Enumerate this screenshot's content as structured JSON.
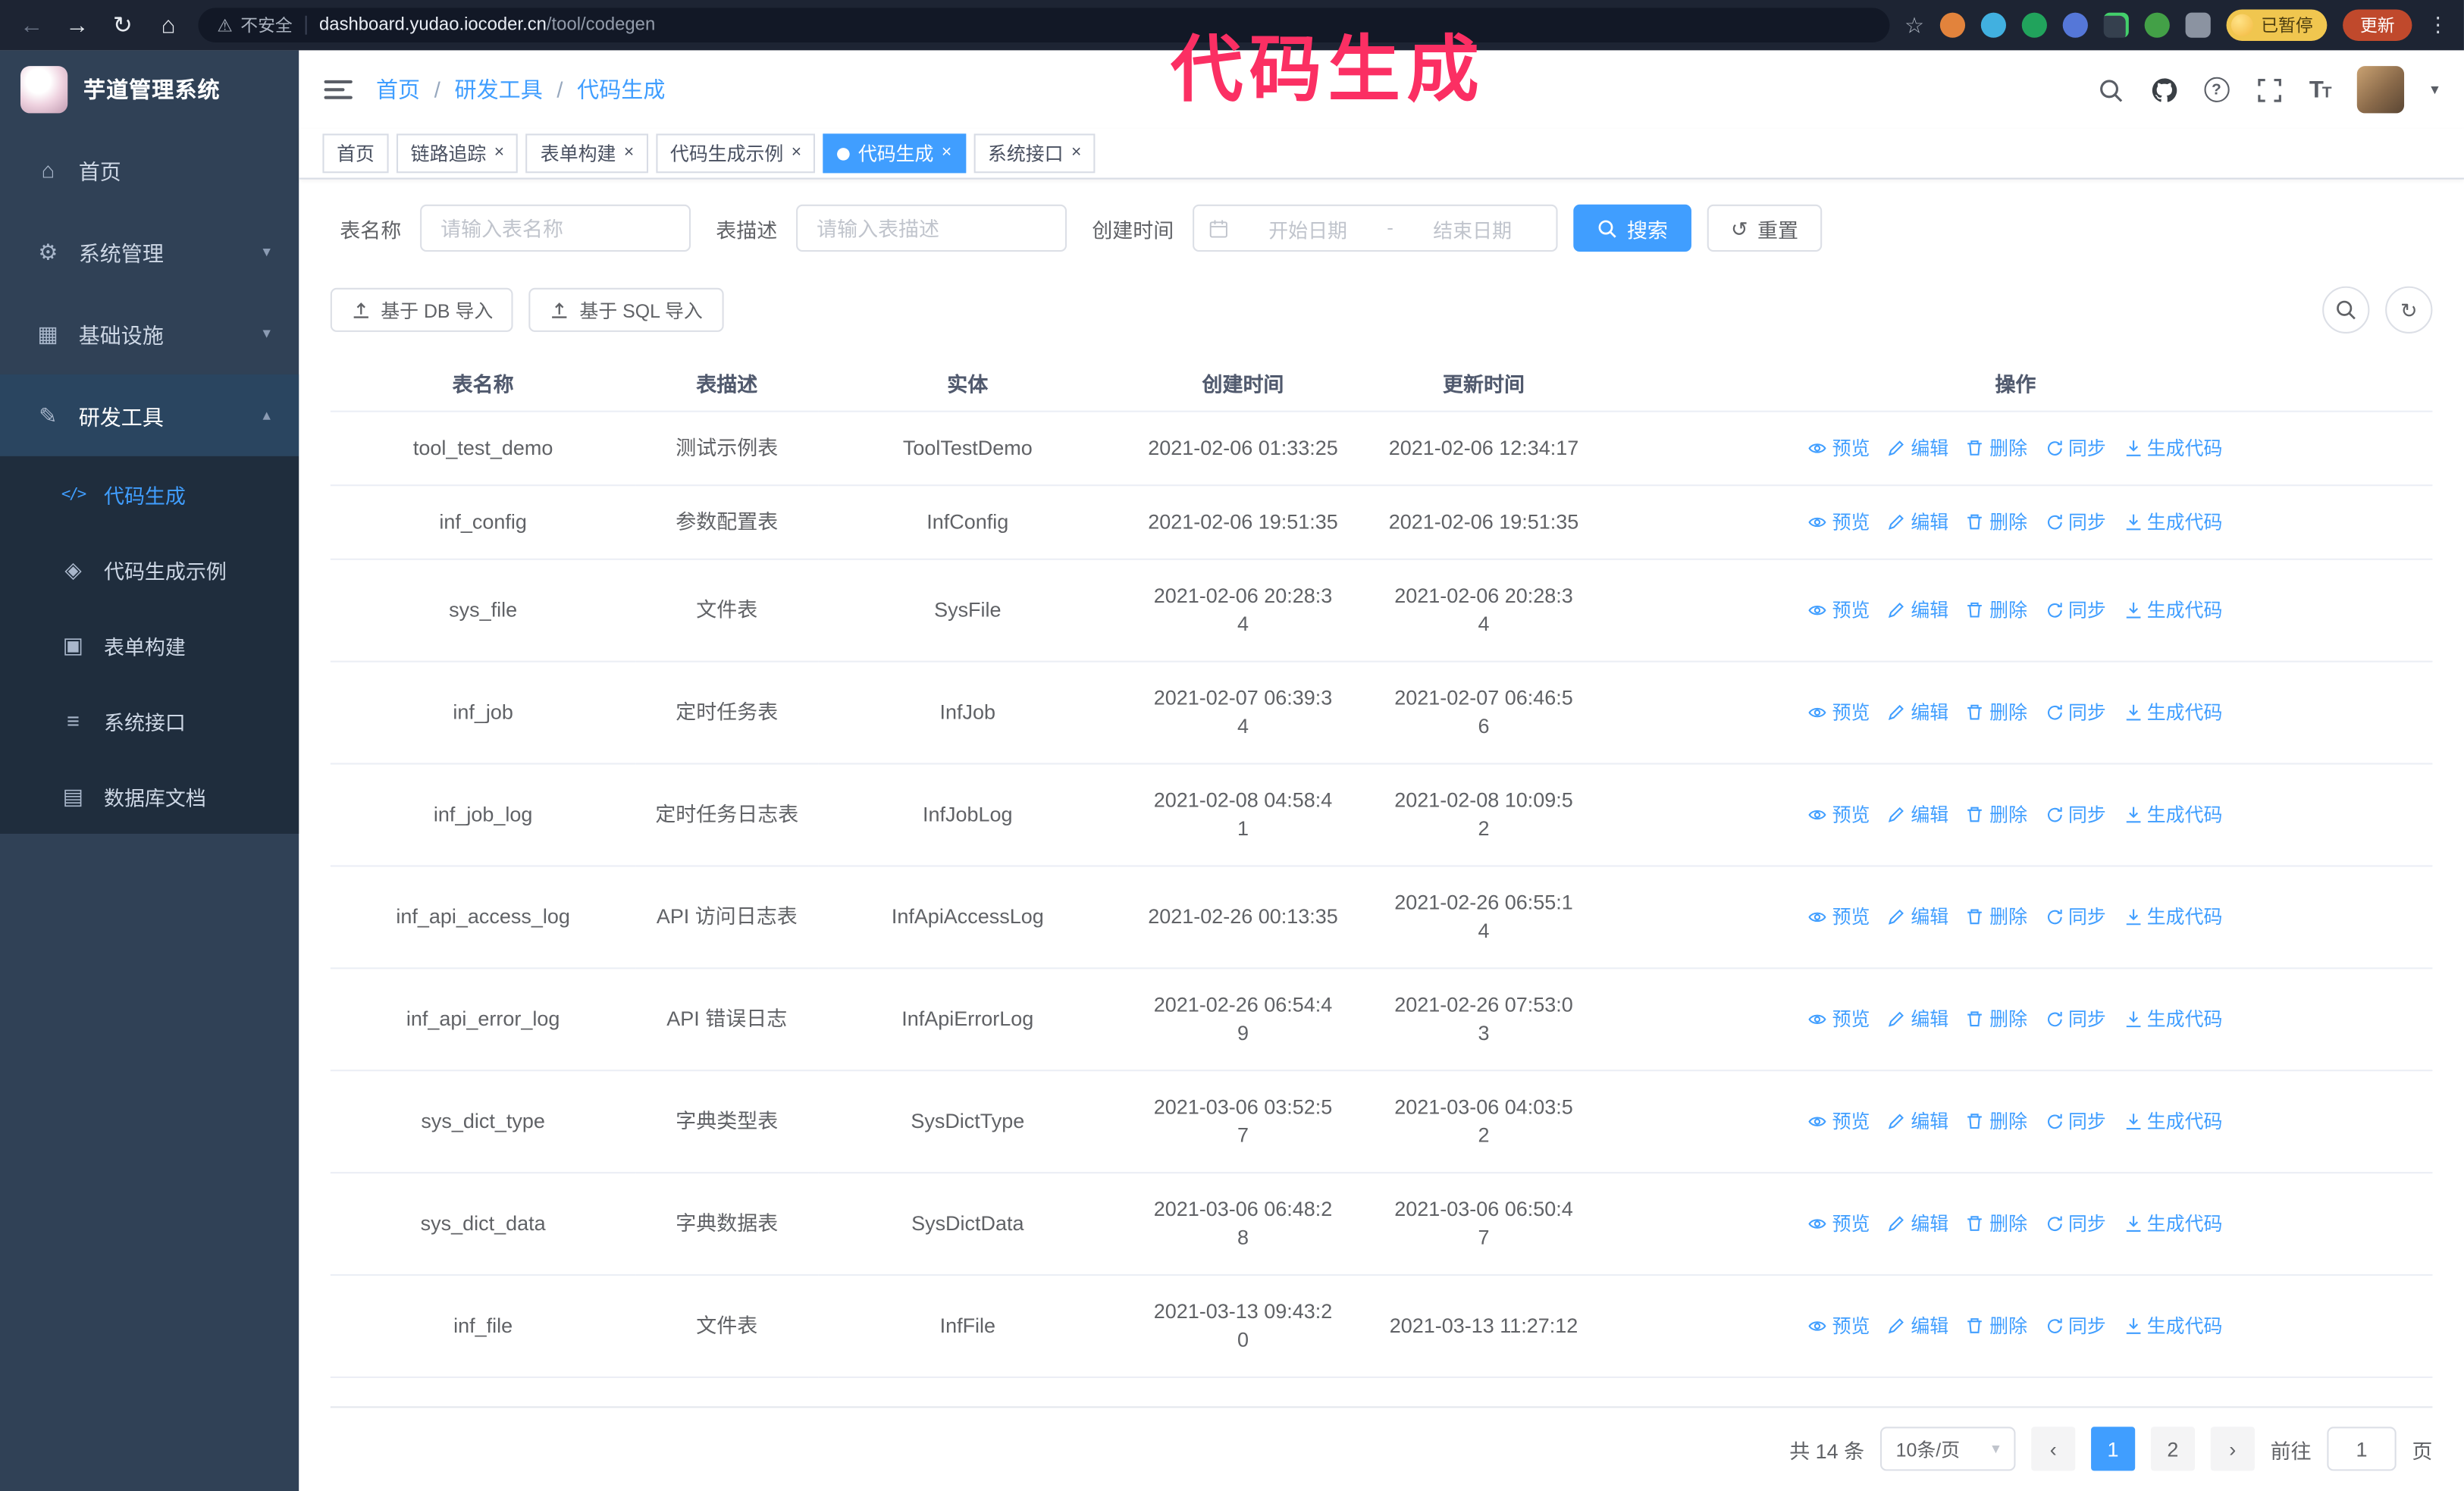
{
  "annotation": {
    "text": "代码生成",
    "color": "#fb2f63"
  },
  "colors": {
    "accent": "#409eff",
    "sidebar_bg": "#304156",
    "submenu_bg": "#1f2d3d",
    "chrome_bg": "#1d2433",
    "update_button_bg": "#c0492c",
    "profile_badge_bg": "#f0c64f"
  },
  "browser": {
    "security_label": "不安全",
    "url_host": "dashboard.yudao.iocoder.cn",
    "url_path": "/tool/codegen",
    "profile_badge": "已暂停",
    "update_button": "更新"
  },
  "sidebar": {
    "logo_title": "芋道管理系统",
    "items": [
      {
        "label": "首页",
        "icon": "home-icon"
      },
      {
        "label": "系统管理",
        "icon": "gear-icon",
        "expandable": true
      },
      {
        "label": "基础设施",
        "icon": "infra-icon",
        "expandable": true
      },
      {
        "label": "研发工具",
        "icon": "tools-icon",
        "expandable": true,
        "expanded": true
      }
    ],
    "submenu": [
      {
        "label": "代码生成",
        "icon": "code-icon",
        "active": true
      },
      {
        "label": "代码生成示例",
        "icon": "example-icon"
      },
      {
        "label": "表单构建",
        "icon": "form-icon"
      },
      {
        "label": "系统接口",
        "icon": "api-icon"
      },
      {
        "label": "数据库文档",
        "icon": "db-doc-icon"
      }
    ]
  },
  "header": {
    "breadcrumb": [
      "首页",
      "研发工具",
      "代码生成"
    ],
    "breadcrumb_separator": "/"
  },
  "tabs": [
    {
      "label": "首页",
      "closable": false,
      "active": false
    },
    {
      "label": "链路追踪",
      "closable": true,
      "active": false
    },
    {
      "label": "表单构建",
      "closable": true,
      "active": false
    },
    {
      "label": "代码生成示例",
      "closable": true,
      "active": false
    },
    {
      "label": "代码生成",
      "closable": true,
      "active": true
    },
    {
      "label": "系统接口",
      "closable": true,
      "active": false
    }
  ],
  "filter": {
    "table_name_label": "表名称",
    "table_name_placeholder": "请输入表名称",
    "table_desc_label": "表描述",
    "table_desc_placeholder": "请输入表描述",
    "create_time_label": "创建时间",
    "date_start_placeholder": "开始日期",
    "date_separator": "-",
    "date_end_placeholder": "结束日期",
    "search_button": "搜索",
    "reset_button": "重置"
  },
  "toolbar": {
    "import_db_button": "基于 DB 导入",
    "import_sql_button": "基于 SQL 导入"
  },
  "table": {
    "columns": [
      "表名称",
      "表描述",
      "实体",
      "创建时间",
      "更新时间",
      "操作"
    ],
    "ops": [
      "预览",
      "编辑",
      "删除",
      "同步",
      "生成代码"
    ],
    "rows": [
      {
        "name": "tool_test_demo",
        "desc": "测试示例表",
        "entity": "ToolTestDemo",
        "created": "2021-02-06 01:33:25",
        "updated": "2021-02-06 12:34:17"
      },
      {
        "name": "inf_config",
        "desc": "参数配置表",
        "entity": "InfConfig",
        "created": "2021-02-06 19:51:35",
        "updated": "2021-02-06 19:51:35"
      },
      {
        "name": "sys_file",
        "desc": "文件表",
        "entity": "SysFile",
        "created": "2021-02-06 20:28:3\n4",
        "updated": "2021-02-06 20:28:3\n4"
      },
      {
        "name": "inf_job",
        "desc": "定时任务表",
        "entity": "InfJob",
        "created": "2021-02-07 06:39:3\n4",
        "updated": "2021-02-07 06:46:5\n6"
      },
      {
        "name": "inf_job_log",
        "desc": "定时任务日志表",
        "entity": "InfJobLog",
        "created": "2021-02-08 04:58:4\n1",
        "updated": "2021-02-08 10:09:5\n2"
      },
      {
        "name": "inf_api_access_log",
        "desc": "API 访问日志表",
        "entity": "InfApiAccessLog",
        "created": "2021-02-26 00:13:35",
        "updated": "2021-02-26 06:55:1\n4"
      },
      {
        "name": "inf_api_error_log",
        "desc": "API 错误日志",
        "entity": "InfApiErrorLog",
        "created": "2021-02-26 06:54:4\n9",
        "updated": "2021-02-26 07:53:0\n3"
      },
      {
        "name": "sys_dict_type",
        "desc": "字典类型表",
        "entity": "SysDictType",
        "created": "2021-03-06 03:52:5\n7",
        "updated": "2021-03-06 04:03:5\n2"
      },
      {
        "name": "sys_dict_data",
        "desc": "字典数据表",
        "entity": "SysDictData",
        "created": "2021-03-06 06:48:2\n8",
        "updated": "2021-03-06 06:50:4\n7"
      },
      {
        "name": "inf_file",
        "desc": "文件表",
        "entity": "InfFile",
        "created": "2021-03-13 09:43:2\n0",
        "updated": "2021-03-13 11:27:12"
      }
    ]
  },
  "pagination": {
    "total": "共 14 条",
    "page_size": "10条/页",
    "pages": [
      "1",
      "2"
    ],
    "active_page": "1",
    "goto_label": "前往",
    "goto_value": "1",
    "goto_suffix": "页"
  }
}
